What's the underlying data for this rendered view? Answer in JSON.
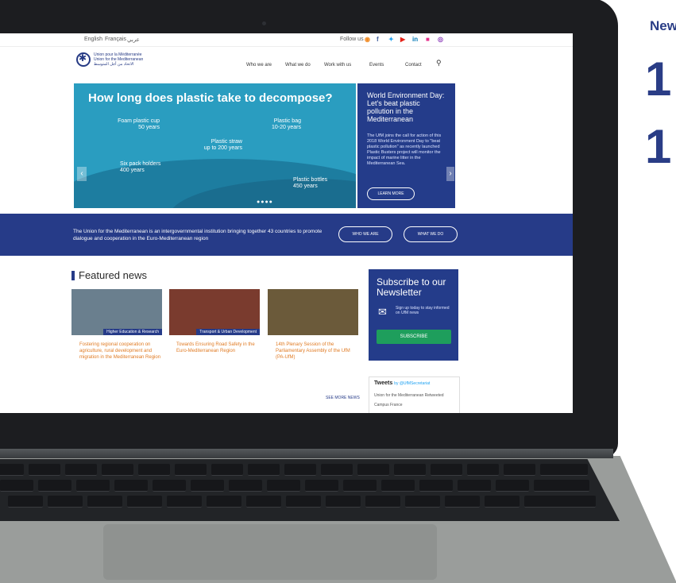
{
  "side_text": {
    "news_heading": "New",
    "digits": [
      "1",
      "1"
    ]
  },
  "website": {
    "top_bar": {
      "languages": [
        "English",
        "Français",
        "عربي"
      ],
      "follow_label": "Follow us",
      "social_icons": [
        "rss-icon",
        "facebook-icon",
        "twitter-icon",
        "youtube-icon",
        "linkedin-icon",
        "flickr-icon",
        "instagram-icon"
      ]
    },
    "logo_text": [
      "Union pour la Méditerranée",
      "Union for the Mediterranean",
      "الاتحاد من أجل المتوسط"
    ],
    "nav_links": [
      "Who we are",
      "What we do",
      "Work with us",
      "Events",
      "Contact"
    ],
    "hero": {
      "title": "How long does plastic take to decompose?",
      "items": [
        {
          "label": "Foam plastic cup",
          "value": "50 years"
        },
        {
          "label": "Plastic bag",
          "value": "10-20 years"
        },
        {
          "label": "Plastic straw",
          "value": "up to 200 years"
        },
        {
          "label": "Six pack holders",
          "value": "400 years"
        },
        {
          "label": "Plastic bottles",
          "value": "450 years"
        }
      ],
      "prev": "‹",
      "next": "›",
      "dots": "●●●●"
    },
    "side_panel": {
      "title": "World Environment Day: Let's beat plastic pollution in the Mediterranean",
      "text": "The UfM joins the call for action of this 2018 World Environment Day to \"beat plastic pollution\" as recently launched Plastic Busters project will monitor the impact of marine litter in the Mediterranean Sea.",
      "button": "LEARN MORE"
    },
    "band": {
      "text": "The Union for the Mediterranean is an intergovernmental institution bringing together 43 countries to promote dialogue and cooperation in the Euro-Mediterranean region",
      "btn_who": "WHO WE ARE",
      "btn_what": "WHAT WE DO"
    },
    "featured": {
      "heading": "Featured news",
      "cards": [
        {
          "tag": "Higher Education & Research",
          "text": "Fostering regional cooperation on agriculture, rural development and migration in the Mediterranean Region"
        },
        {
          "tag": "Transport & Urban Development",
          "text": "Towards Ensuring Road Safety in the Euro-Mediterranean Region"
        },
        {
          "tag": "",
          "text": "14th Plenary Session of the Parliamentary Assembly of the UfM (PA-UfM)"
        }
      ],
      "see_more": "SEE MORE NEWS"
    },
    "subscribe": {
      "title": "Subscribe to our Newsletter",
      "text": "Sign up today to stay informed on UfM news",
      "button": "SUBSCRIBE"
    },
    "tweets": {
      "title": "Tweets",
      "handle": "by @UfMSecretariat",
      "line1": "Union for the Mediterranean Retweeted",
      "line2": "Campus France"
    }
  }
}
